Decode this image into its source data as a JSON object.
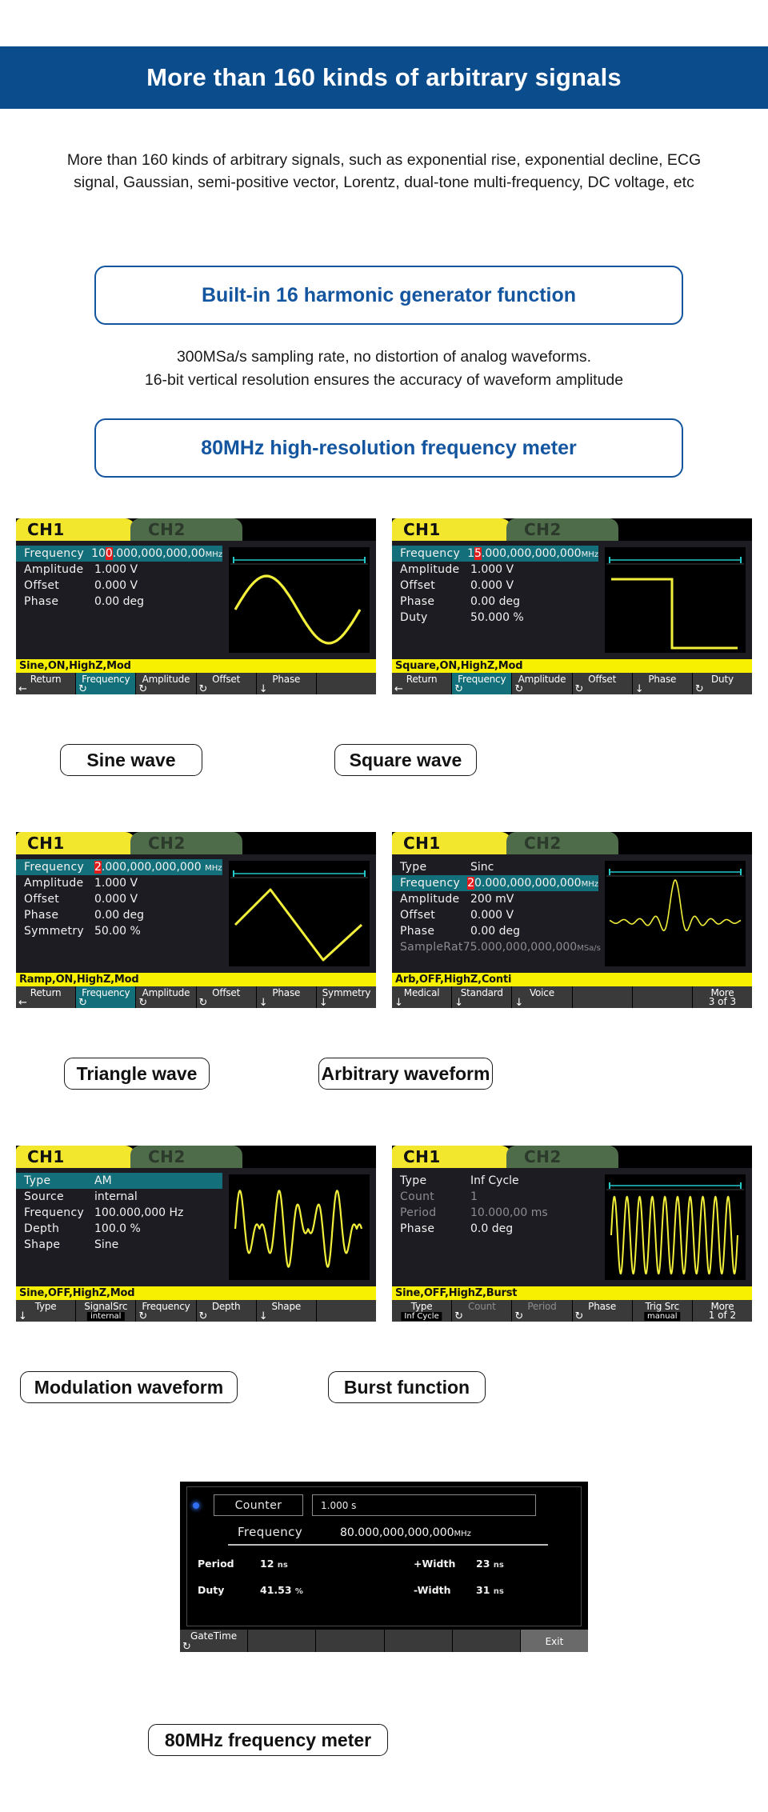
{
  "banner": {
    "title": "More than 160 kinds of arbitrary signals"
  },
  "intro": "More than 160 kinds of arbitrary signals, such as exponential rise, exponential decline, ECG signal, Gaussian, semi-positive vector, Lorentz, dual-tone multi-frequency, DC voltage, etc",
  "callout1": "Built-in 16 harmonic generator function",
  "midtext": "300MSa/s sampling rate, no distortion of analog waveforms.\n16-bit vertical resolution ensures the accuracy of waveform amplitude",
  "callout2": "80MHz high-resolution frequency meter",
  "colors": {
    "banner_blue": "#0b4c8c",
    "callout_blue": "#14559f",
    "tab_active_yellow": "#f2e72c",
    "tab_inactive_green": "#4e6b4a",
    "status_yellow": "#f7f000",
    "select_teal": "#13707a",
    "cursor_red": "#e51c1c",
    "waveform_yellow": "#f2ef3a",
    "marker_cyan": "#22c8c8"
  },
  "screens": [
    {
      "id": "sine",
      "caption": "Sine wave",
      "tabs": {
        "active": "CH1",
        "inactive": "CH2"
      },
      "params": [
        {
          "label": "Frequency",
          "value": "100.000,000,000,00",
          "unit": "MHz",
          "selected": true,
          "cursor_index": 2
        },
        {
          "label": "Amplitude",
          "value": "1.000 V"
        },
        {
          "label": "Offset",
          "value": "0.000 V"
        },
        {
          "label": "Phase",
          "value": "0.00 deg"
        }
      ],
      "status": "Sine,ON,HighZ,Mod",
      "softkeys": [
        {
          "label": "Return",
          "icon": "arrow-left"
        },
        {
          "label": "Frequency",
          "icon": "knob",
          "active": true
        },
        {
          "label": "Amplitude",
          "icon": "knob"
        },
        {
          "label": "Offset",
          "icon": "knob"
        },
        {
          "label": "Phase",
          "icon": "arrow-down"
        },
        {
          "label": ""
        }
      ]
    },
    {
      "id": "square",
      "caption": "Square wave",
      "tabs": {
        "active": "CH1",
        "inactive": "CH2"
      },
      "params": [
        {
          "label": "Frequency",
          "value": "15.000,000,000,000",
          "unit": "MHz",
          "selected": true,
          "cursor_index": 1
        },
        {
          "label": "Amplitude",
          "value": "1.000 V"
        },
        {
          "label": "Offset",
          "value": "0.000 V"
        },
        {
          "label": "Phase",
          "value": "0.00 deg"
        },
        {
          "label": "Duty",
          "value": "50.000 %"
        }
      ],
      "status": "Square,ON,HighZ,Mod",
      "softkeys": [
        {
          "label": "Return",
          "icon": "arrow-left"
        },
        {
          "label": "Frequency",
          "icon": "knob",
          "active": true
        },
        {
          "label": "Amplitude",
          "icon": "knob"
        },
        {
          "label": "Offset",
          "icon": "knob"
        },
        {
          "label": "Phase",
          "icon": "arrow-down"
        },
        {
          "label": "Duty",
          "icon": "knob"
        }
      ]
    },
    {
      "id": "triangle",
      "caption": "Triangle wave",
      "tabs": {
        "active": "CH1",
        "inactive": "CH2"
      },
      "params": [
        {
          "label": "Frequency",
          "value": "2.000,000,000,000 ",
          "unit": "MHz",
          "selected": true,
          "cursor_index": 0
        },
        {
          "label": "Amplitude",
          "value": "1.000 V"
        },
        {
          "label": "Offset",
          "value": "0.000 V"
        },
        {
          "label": "Phase",
          "value": "0.00 deg"
        },
        {
          "label": "Symmetry",
          "value": "50.00 %"
        }
      ],
      "status": "Ramp,ON,HighZ,Mod",
      "softkeys": [
        {
          "label": "Return",
          "icon": "arrow-left"
        },
        {
          "label": "Frequency",
          "icon": "knob",
          "active": true
        },
        {
          "label": "Amplitude",
          "icon": "knob"
        },
        {
          "label": "Offset",
          "icon": "knob"
        },
        {
          "label": "Phase",
          "icon": "arrow-down"
        },
        {
          "label": "Symmetry",
          "icon": "arrow-down"
        }
      ]
    },
    {
      "id": "arbitrary",
      "caption": "Arbitrary waveform",
      "tabs": {
        "active": "CH1",
        "inactive": "CH2"
      },
      "params": [
        {
          "label": "Type",
          "value": "Sinc"
        },
        {
          "label": "Frequency",
          "value": "20.000,000,000,000",
          "unit": "MHz",
          "selected": true,
          "cursor_index": 0
        },
        {
          "label": "Amplitude",
          "value": "200 mV"
        },
        {
          "label": "Offset",
          "value": "0.000 V"
        },
        {
          "label": "Phase",
          "value": "0.00 deg"
        },
        {
          "label": "SampleRat",
          "value": "75.000,000,000,000",
          "unit": "MSa/s",
          "dim": true
        }
      ],
      "status": "Arb,OFF,HighZ,Conti",
      "softkeys": [
        {
          "label": "Medical",
          "icon": "arrow-down"
        },
        {
          "label": "Standard",
          "icon": "arrow-down"
        },
        {
          "label": "Voice",
          "icon": "arrow-down"
        },
        {
          "label": ""
        },
        {
          "label": ""
        },
        {
          "label": "More",
          "page": "3 of 3"
        }
      ]
    },
    {
      "id": "modulation",
      "caption": "Modulation waveform",
      "tabs": {
        "active": "CH1",
        "inactive": "CH2"
      },
      "params": [
        {
          "label": "Type",
          "value": "AM",
          "selected": true
        },
        {
          "label": "Source",
          "value": "internal"
        },
        {
          "label": "Frequency",
          "value": "100.000,000 Hz"
        },
        {
          "label": "Depth",
          "value": "100.0 %"
        },
        {
          "label": "Shape",
          "value": "Sine"
        }
      ],
      "status": "Sine,OFF,HighZ,Mod",
      "softkeys": [
        {
          "label": "Type",
          "icon": "arrow-down"
        },
        {
          "label": "SignalSrc",
          "sub": "internal"
        },
        {
          "label": "Frequency",
          "icon": "knob"
        },
        {
          "label": "Depth",
          "icon": "knob"
        },
        {
          "label": "Shape",
          "icon": "arrow-down"
        },
        {
          "label": ""
        }
      ]
    },
    {
      "id": "burst",
      "caption": "Burst function",
      "tabs": {
        "active": "CH1",
        "inactive": "CH2"
      },
      "params": [
        {
          "label": "Type",
          "value": "Inf Cycle"
        },
        {
          "label": "Count",
          "value": "1",
          "dim": true
        },
        {
          "label": "Period",
          "value": "10.000,00 ms",
          "dim": true
        },
        {
          "label": "Phase",
          "value": "0.0 deg"
        }
      ],
      "status": "Sine,OFF,HighZ,Burst",
      "softkeys": [
        {
          "label": "Type",
          "sub": "Inf Cycle"
        },
        {
          "label": "Count",
          "icon": "knob",
          "dim": true
        },
        {
          "label": "Period",
          "icon": "knob",
          "dim": true
        },
        {
          "label": "Phase",
          "icon": "knob"
        },
        {
          "label": "Trig Src",
          "sub": "manual"
        },
        {
          "label": "More",
          "page": "1 of 2"
        }
      ]
    }
  ],
  "freq_meter": {
    "caption": "80MHz frequency meter",
    "counter_label": "Counter",
    "gate_value": "1.000 s",
    "frequency_label": "Frequency",
    "frequency_value": "80.000,000,000,000",
    "frequency_unit": "MHz",
    "cells": [
      {
        "label": "Period",
        "value": "12",
        "unit": "ns"
      },
      {
        "label": "+Width",
        "value": "23",
        "unit": "ns"
      },
      {
        "label": "Duty",
        "value": "41.53",
        "unit": "%"
      },
      {
        "label": "-Width",
        "value": "31",
        "unit": "ns"
      }
    ],
    "softkeys": [
      {
        "label": "GateTime",
        "icon": "knob"
      },
      {
        "label": ""
      },
      {
        "label": ""
      },
      {
        "label": ""
      },
      {
        "label": ""
      },
      {
        "label": "Exit"
      }
    ]
  }
}
